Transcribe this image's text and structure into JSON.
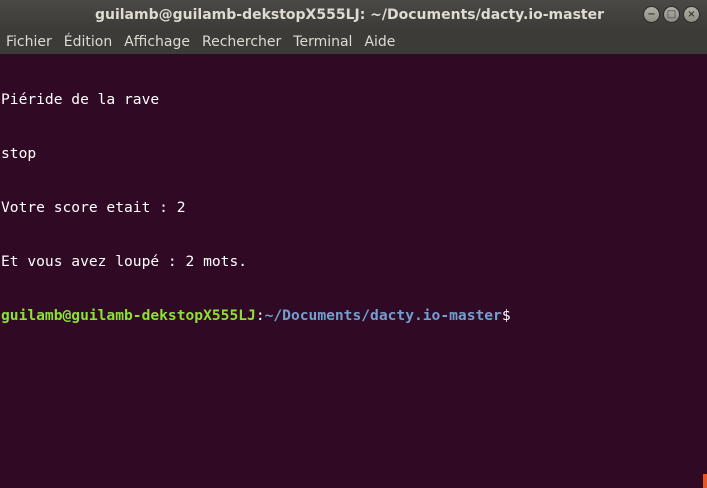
{
  "window": {
    "title": "guilamb@guilamb-dekstopX555LJ: ~/Documents/dacty.io-master",
    "controls": {
      "minimize_icon": "minimize-icon",
      "maximize_icon": "maximize-icon",
      "close_icon": "close-icon",
      "minimize_glyph": "−",
      "maximize_glyph": "□",
      "close_glyph": "×"
    }
  },
  "menubar": {
    "items": [
      "Fichier",
      "Édition",
      "Affichage",
      "Rechercher",
      "Terminal",
      "Aide"
    ]
  },
  "terminal": {
    "lines": [
      "Piéride de la rave",
      "stop",
      "Votre score etait : 2",
      "Et vous avez loupé : 2 mots."
    ],
    "prompt": {
      "user_host": "guilamb@guilamb-dekstopX555LJ",
      "separator": ":",
      "path": "~/Documents/dacty.io-master",
      "symbol": "$"
    }
  },
  "colors": {
    "background": "#300a24",
    "titlebar": "#3c3b37",
    "prompt_user": "#8ae234",
    "prompt_path": "#729fcf",
    "text": "#ffffff",
    "scroll_marker": "#e95420"
  }
}
